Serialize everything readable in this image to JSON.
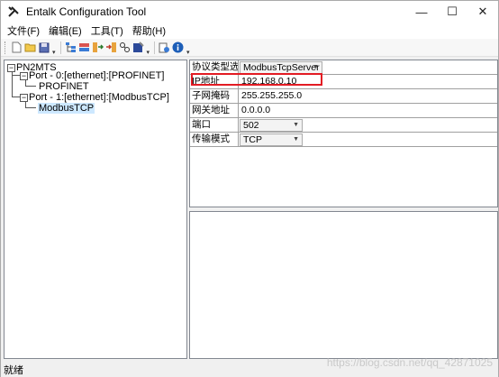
{
  "window": {
    "title": "Entalk Configuration Tool",
    "controls": {
      "minimize": "—",
      "maximize": "☐",
      "close": "✕"
    }
  },
  "menu": {
    "items": [
      "文件(F)",
      "编辑(E)",
      "工具(T)",
      "帮助(H)"
    ]
  },
  "toolbar": {
    "icons": [
      "new-file-icon",
      "open-folder-icon",
      "save-icon",
      "tree-icon",
      "device-icon",
      "export-icon",
      "import-icon",
      "link-icon",
      "settings-icon",
      "upload-icon",
      "info-icon"
    ]
  },
  "tree": {
    "root": "PN2MTS",
    "port0": "Port - 0:[ethernet]:[PROFINET]",
    "port0_child": "PROFINET",
    "port1": "Port - 1:[ethernet]:[ModbusTCP]",
    "port1_child": "ModbusTCP",
    "expander_minus": "−"
  },
  "properties": {
    "protocol": {
      "label": "协议类型选择",
      "value": "ModbusTcpServer"
    },
    "ip": {
      "label": "IP地址",
      "value": "192.168.0.10"
    },
    "subnet": {
      "label": "子网掩码",
      "value": "255.255.255.0"
    },
    "gateway": {
      "label": "网关地址",
      "value": "0.0.0.0"
    },
    "port": {
      "label": "端口",
      "value": "502"
    },
    "transfer": {
      "label": "传输模式",
      "value": "TCP"
    },
    "arrow": "▼"
  },
  "status": {
    "text": "就绪"
  },
  "watermark": {
    "text": "https://blog.csdn.net/qq_42871025"
  }
}
